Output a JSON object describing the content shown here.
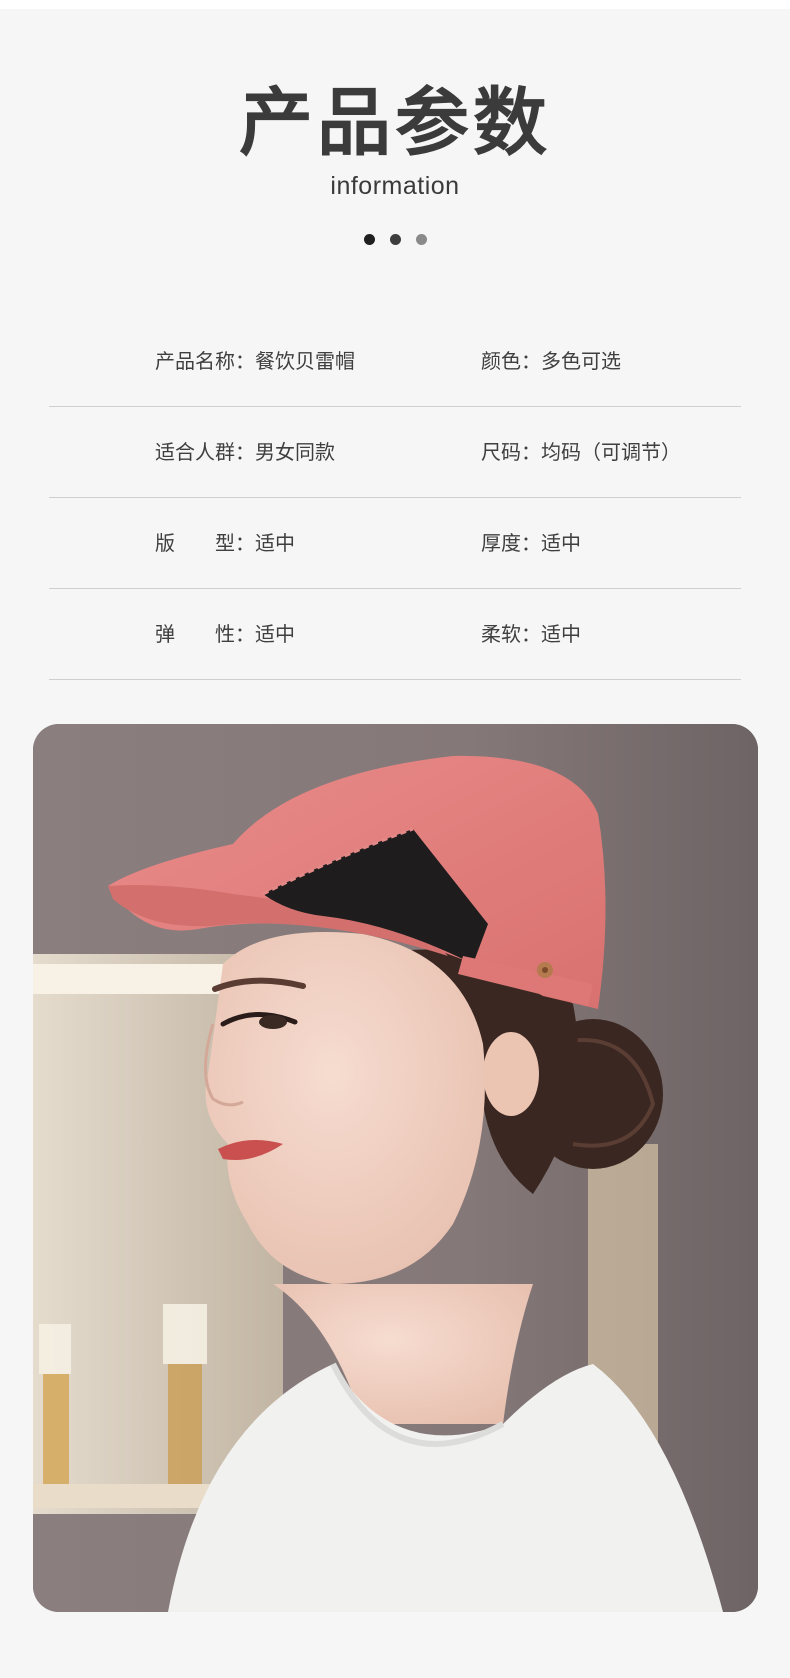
{
  "header": {
    "title": "产品参数",
    "subtitle": "information",
    "dot_colors": [
      "#1f1f1f",
      "#3d3d3d",
      "#8a8a8a"
    ]
  },
  "specs": [
    {
      "left": {
        "label": "产品名称：",
        "value": "餐饮贝雷帽"
      },
      "right": {
        "label": "颜色：",
        "value": "多色可选"
      }
    },
    {
      "left": {
        "label": "适合人群：",
        "value": "男女同款"
      },
      "right": {
        "label": "尺码：",
        "value": "均码（可调节）"
      }
    },
    {
      "left": {
        "label": "版　　型：",
        "value": "适中"
      },
      "right": {
        "label": "厚度：",
        "value": "适中"
      }
    },
    {
      "left": {
        "label": "弹　　性：",
        "value": "适中"
      },
      "right": {
        "label": "柔软：",
        "value": "适中"
      }
    }
  ],
  "photo": {
    "hat_color": "#e07f7e",
    "mesh_color": "#1f1c1e",
    "background_color": "#7f7373",
    "shirt_color": "#f0f0ee",
    "hair_color": "#3a2721"
  }
}
